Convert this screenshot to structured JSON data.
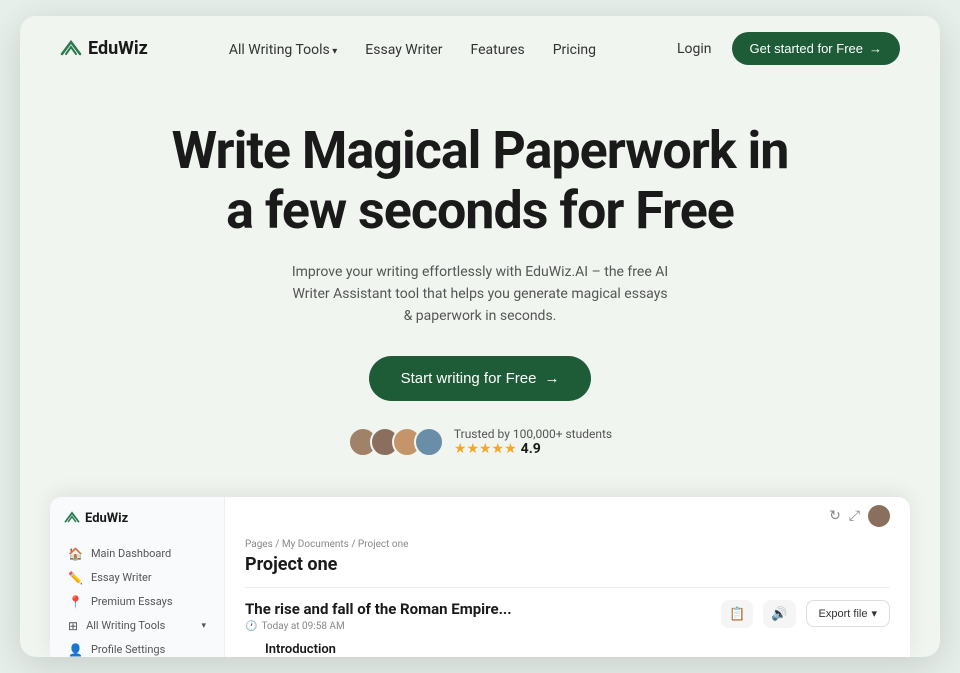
{
  "nav": {
    "logo_text": "EduWiz",
    "links": [
      {
        "label": "All Writing Tools",
        "has_arrow": true
      },
      {
        "label": "Essay Writer",
        "has_arrow": false
      },
      {
        "label": "Features",
        "has_arrow": false
      },
      {
        "label": "Pricing",
        "has_arrow": false
      }
    ],
    "login_label": "Login",
    "cta_label": "Get started for Free",
    "cta_arrow": "→"
  },
  "hero": {
    "heading_line1": "Write Magical Paperwork in",
    "heading_line2": "a few seconds for Free",
    "subtext": "Improve your writing effortlessly with EduWiz.AI – the free AI Writer Assistant tool that helps you generate magical essays & paperwork in seconds.",
    "cta_label": "Start writing for Free",
    "cta_arrow": "→",
    "trust_text": "Trusted by 100,000+ students",
    "rating": "4.9",
    "stars": "★★★★★"
  },
  "app_preview": {
    "logo_text": "EduWiz",
    "breadcrumb": "Pages / My Documents / Project one",
    "project_title": "Project one",
    "sidebar_items": [
      {
        "icon": "🏠",
        "label": "Main Dashboard",
        "active": false
      },
      {
        "icon": "✏️",
        "label": "Essay Writer",
        "active": false
      },
      {
        "icon": "📍",
        "label": "Premium Essays",
        "active": false
      },
      {
        "icon": "⊞",
        "label": "All Writing Tools",
        "active": false,
        "arrow": "▾"
      },
      {
        "icon": "👤",
        "label": "Profile Settings",
        "active": false
      }
    ],
    "doc_title": "The rise and fall of the Roman Empire...",
    "doc_time": "Today at 09:58 AM",
    "section_label": "Introduction",
    "export_label": "Export file",
    "export_arrow": "▾"
  },
  "colors": {
    "primary_green": "#1e5c38",
    "light_bg": "#f0f5f0",
    "logo_green": "#2d7a4f"
  }
}
